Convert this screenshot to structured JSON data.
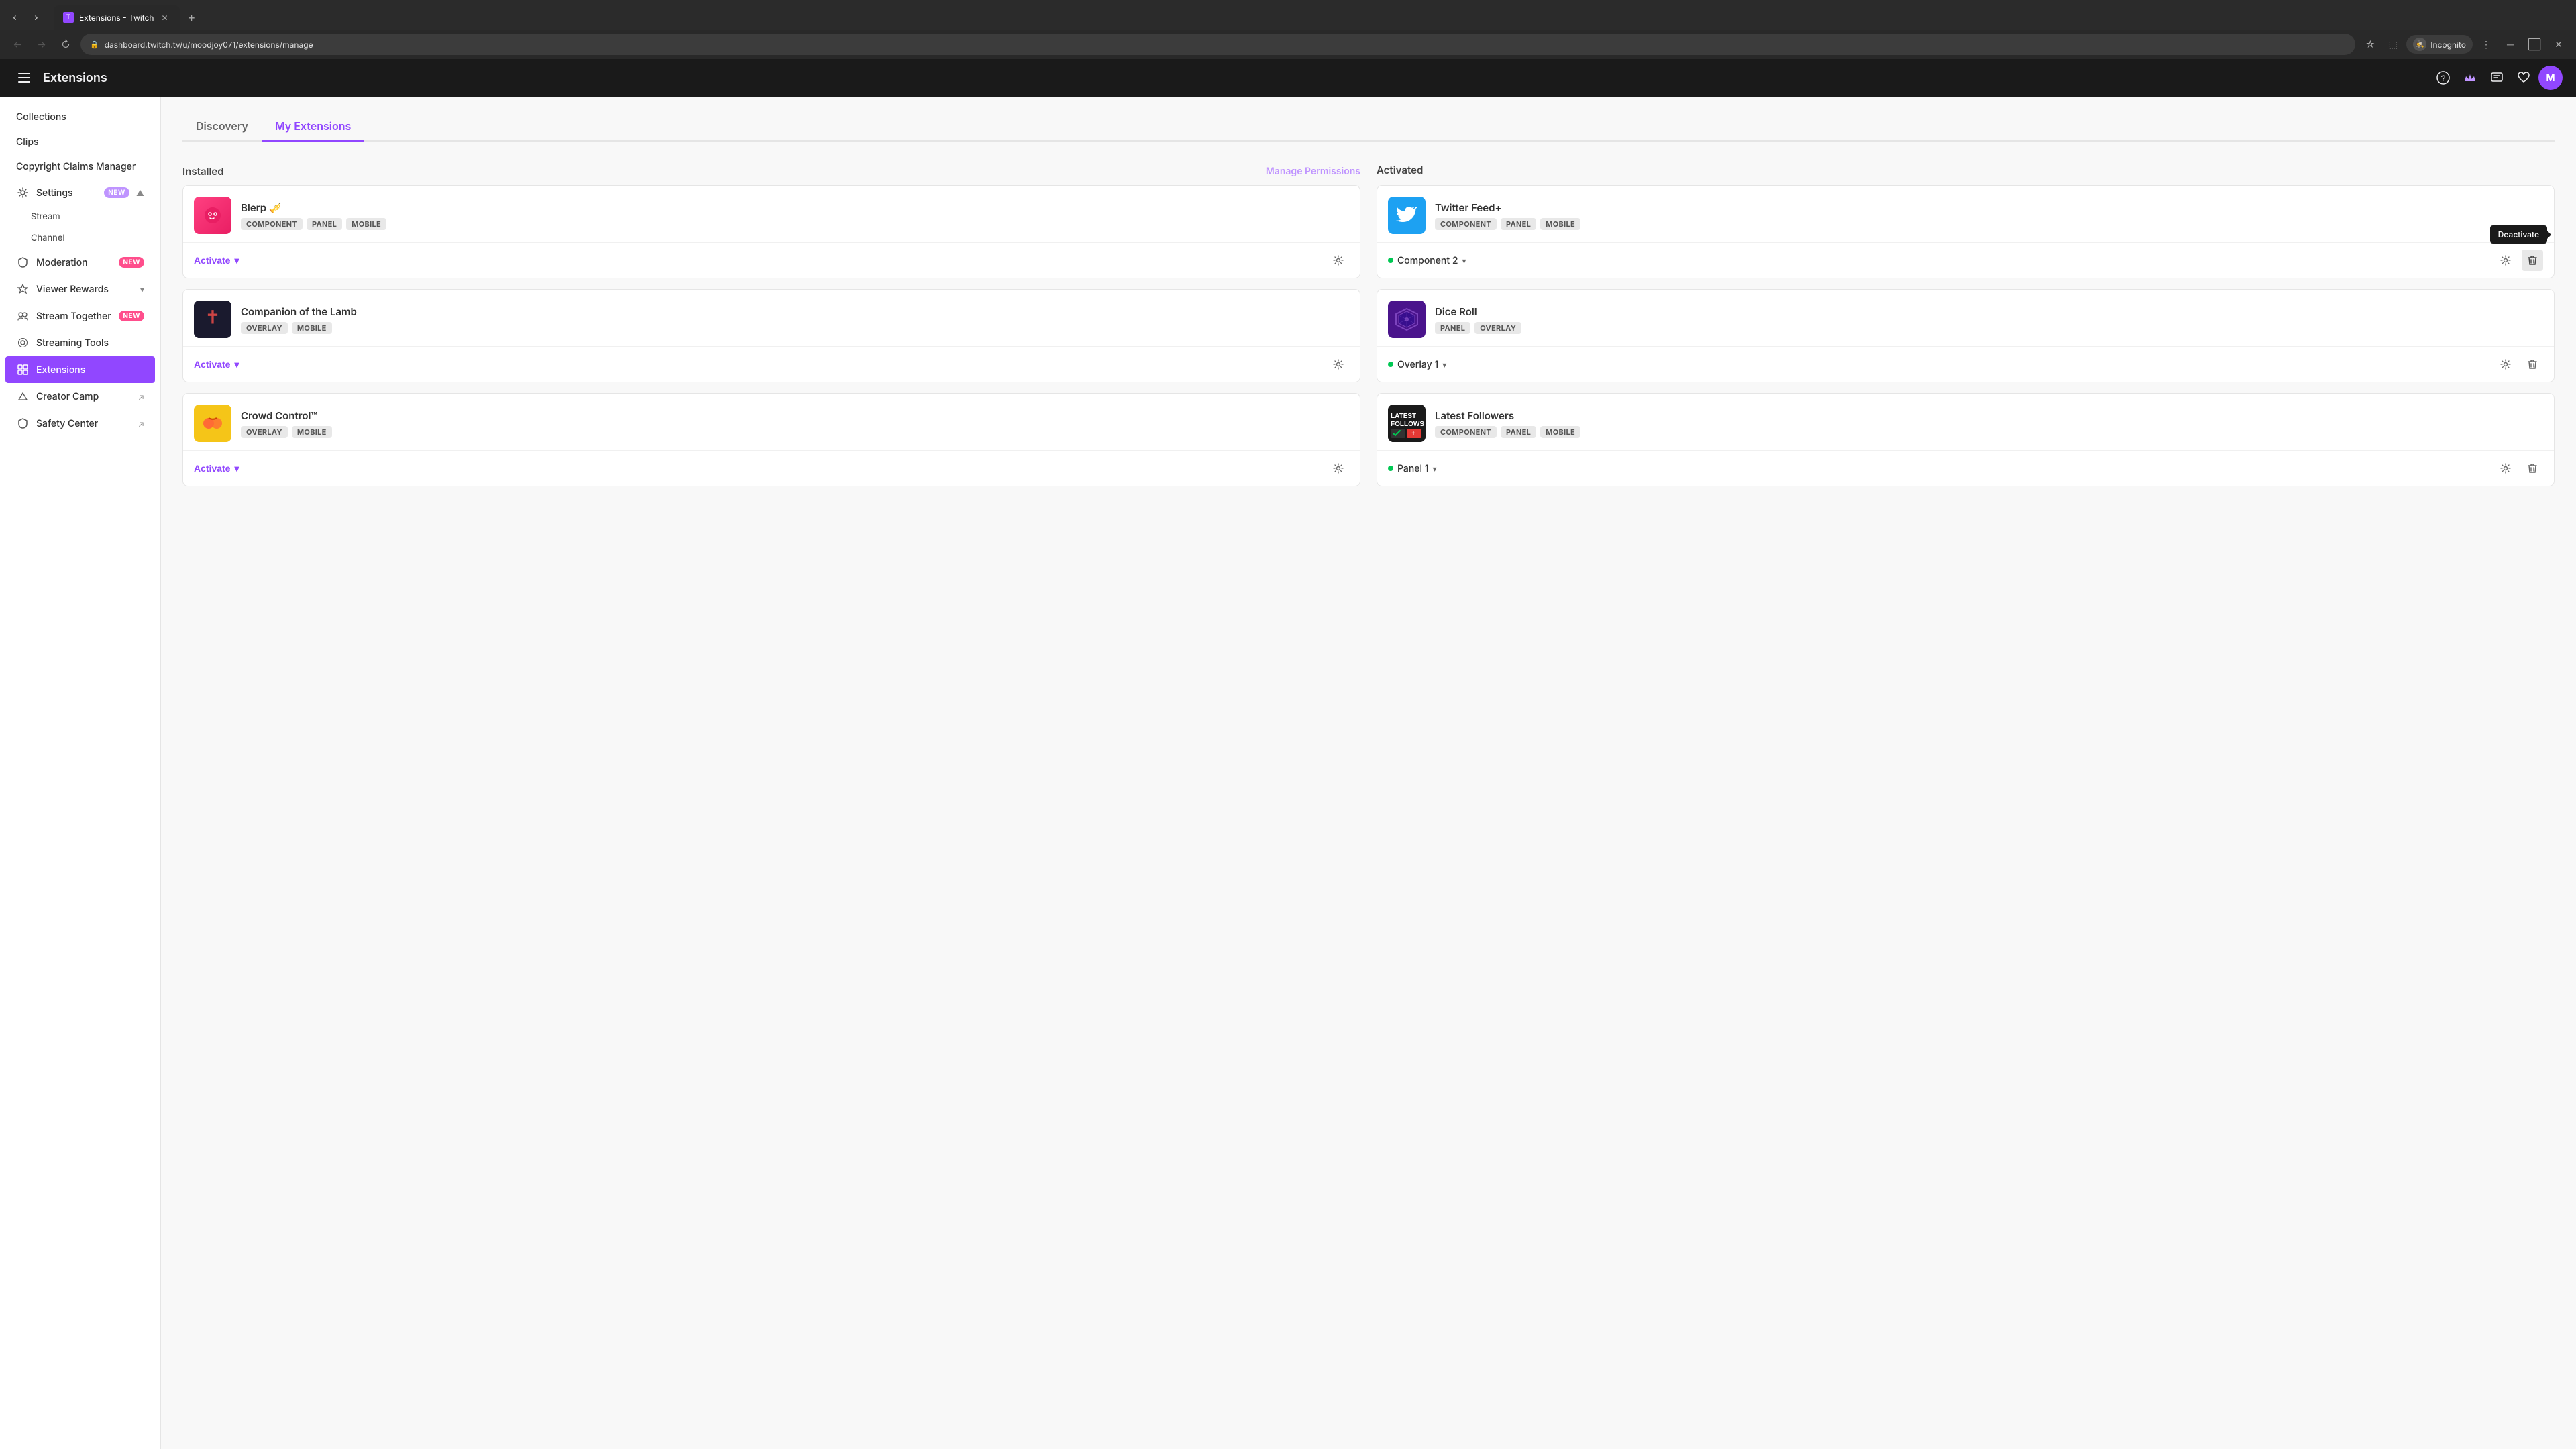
{
  "browser": {
    "tab_favicon": "T",
    "tab_title": "Extensions - Twitch",
    "new_tab_icon": "+",
    "back_icon": "←",
    "forward_icon": "→",
    "refresh_icon": "↻",
    "url": "dashboard.twitch.tv/u/moodjoy071/extensions/manage",
    "star_icon": "☆",
    "window_icon": "⬜",
    "incognito_label": "Incognito",
    "more_icon": "⋮",
    "minimize_icon": "─",
    "maximize_icon": "⬜",
    "close_icon": "✕"
  },
  "header": {
    "hamburger_icon": "≡",
    "title": "Extensions",
    "help_icon": "?",
    "purple_icon": "✦",
    "notifications_icon": "✉",
    "heart_icon": "♡",
    "avatar_letter": "M"
  },
  "sidebar": {
    "items": [
      {
        "id": "collections",
        "label": "Collections",
        "icon": "",
        "has_icon": false
      },
      {
        "id": "clips",
        "label": "Clips",
        "icon": "",
        "has_icon": false
      },
      {
        "id": "copyright",
        "label": "Copyright Claims Manager",
        "icon": "",
        "has_icon": false
      },
      {
        "id": "settings",
        "label": "Settings",
        "icon": "⚙",
        "badge": "NEW",
        "badge_type": "purple",
        "expandable": true
      },
      {
        "id": "stream",
        "label": "Stream",
        "icon": "",
        "sub": true
      },
      {
        "id": "channel",
        "label": "Channel",
        "icon": "",
        "sub": true
      },
      {
        "id": "moderation",
        "label": "Moderation",
        "icon": "🛡",
        "badge": "NEW",
        "badge_type": "pink"
      },
      {
        "id": "viewer-rewards",
        "label": "Viewer Rewards",
        "icon": "⭐",
        "expandable": true
      },
      {
        "id": "stream-together",
        "label": "Stream Together",
        "icon": "👥",
        "badge": "NEW",
        "badge_type": "pink"
      },
      {
        "id": "streaming-tools",
        "label": "Streaming Tools",
        "icon": "🎙"
      },
      {
        "id": "extensions",
        "label": "Extensions",
        "icon": "🧩",
        "active": true
      },
      {
        "id": "creator-camp",
        "label": "Creator Camp",
        "icon": "🏕",
        "external": true
      },
      {
        "id": "safety-center",
        "label": "Safety Center",
        "icon": "🛡",
        "external": true
      }
    ]
  },
  "main": {
    "tabs": [
      {
        "id": "discovery",
        "label": "Discovery",
        "active": false
      },
      {
        "id": "my-extensions",
        "label": "My Extensions",
        "active": true
      }
    ],
    "installed_header": "Installed",
    "activated_header": "Activated",
    "manage_permissions_label": "Manage Permissions",
    "installed_extensions": [
      {
        "id": "blerp",
        "name": "Blerp 🎺",
        "icon_class": "blerp-icon",
        "icon_text": "✱",
        "tags": [
          "COMPONENT",
          "PANEL",
          "MOBILE"
        ],
        "footer_type": "activate",
        "activate_label": "Activate",
        "chevron": "▾",
        "settings_icon": "⚙",
        "delete_icon": "🗑"
      },
      {
        "id": "companion",
        "name": "Companion of the Lamb",
        "icon_class": "companion-icon",
        "icon_text": "🐑",
        "tags": [
          "OVERLAY",
          "MOBILE"
        ],
        "footer_type": "activate",
        "activate_label": "Activate",
        "chevron": "▾",
        "settings_icon": "⚙",
        "delete_icon": "🗑"
      },
      {
        "id": "crowd-control",
        "name": "Crowd Control™",
        "icon_class": "crowd-icon",
        "icon_text": "🎮",
        "tags": [
          "OVERLAY",
          "MOBILE"
        ],
        "footer_type": "activate",
        "activate_label": "Activate",
        "chevron": "▾",
        "settings_icon": "⚙",
        "delete_icon": "🗑"
      }
    ],
    "activated_extensions": [
      {
        "id": "twitter-feed",
        "name": "Twitter Feed+",
        "icon_class": "twitter-icon",
        "icon_text": "🐦",
        "tags": [
          "COMPONENT",
          "PANEL",
          "MOBILE"
        ],
        "footer_type": "active",
        "slot_label": "Component 2",
        "slot_chevron": "▾",
        "settings_icon": "⚙",
        "delete_icon": "🗑",
        "show_deactivate_tooltip": true,
        "deactivate_tooltip": "Deactivate"
      },
      {
        "id": "dice-roll",
        "name": "Dice Roll",
        "icon_class": "dice-icon",
        "icon_text": "🎲",
        "tags": [
          "PANEL",
          "OVERLAY"
        ],
        "footer_type": "active",
        "slot_label": "Overlay 1",
        "slot_chevron": "▾",
        "settings_icon": "⚙",
        "delete_icon": "🗑",
        "show_deactivate_tooltip": false
      },
      {
        "id": "latest-followers",
        "name": "Latest Followers",
        "icon_class": "followers-icon",
        "icon_text": "👥",
        "tags": [
          "COMPONENT",
          "PANEL",
          "MOBILE"
        ],
        "footer_type": "active",
        "slot_label": "Panel 1",
        "slot_chevron": "▾",
        "settings_icon": "⚙",
        "delete_icon": "🗑",
        "show_deactivate_tooltip": false
      }
    ]
  }
}
